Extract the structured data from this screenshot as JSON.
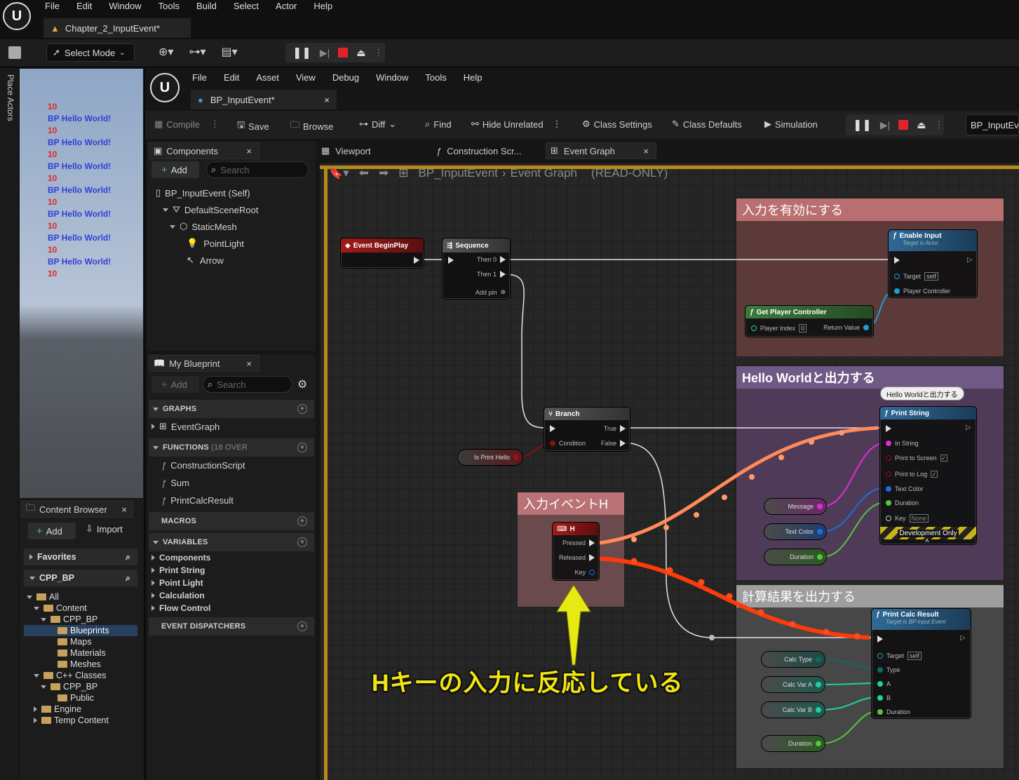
{
  "main_menu": [
    "File",
    "Edit",
    "Window",
    "Tools",
    "Build",
    "Select",
    "Actor",
    "Help"
  ],
  "level_tab": "Chapter_2_InputEvent*",
  "select_mode": "Select Mode",
  "place_actors": "Place Actors",
  "viewport_log": [
    "10",
    "BP Hello World!",
    "10",
    "BP Hello World!",
    "10",
    "BP Hello World!",
    "10",
    "BP Hello World!",
    "10",
    "BP Hello World!",
    "10",
    "BP Hello World!",
    "10",
    "BP Hello World!",
    "10"
  ],
  "bp_menu": [
    "File",
    "Edit",
    "Asset",
    "View",
    "Debug",
    "Window",
    "Tools",
    "Help"
  ],
  "bp_tab": "BP_InputEvent*",
  "toolbar": {
    "compile": "Compile",
    "save": "Save",
    "browse": "Browse",
    "diff": "Diff",
    "find": "Find",
    "hide_unrelated": "Hide Unrelated",
    "class_settings": "Class Settings",
    "class_defaults": "Class Defaults",
    "simulation": "Simulation",
    "debug_object": "BP_InputEve"
  },
  "components": {
    "tab": "Components",
    "add": "Add",
    "search_placeholder": "Search",
    "items": [
      "BP_InputEvent (Self)",
      "DefaultSceneRoot",
      "StaticMesh",
      "PointLight",
      "Arrow"
    ]
  },
  "my_blueprint": {
    "tab": "My Blueprint",
    "add": "Add",
    "search_placeholder": "Search",
    "graphs_label": "GRAPHS",
    "event_graph": "EventGraph",
    "functions_label": "FUNCTIONS",
    "functions_count": "(18 OVER",
    "functions": [
      "ConstructionScript",
      "Sum",
      "PrintCalcResult"
    ],
    "macros_label": "MACROS",
    "variables_label": "VARIABLES",
    "variables": [
      "Components",
      "Print String",
      "Point Light",
      "Calculation",
      "Flow Control"
    ],
    "dispatchers_label": "EVENT DISPATCHERS"
  },
  "content_browser": {
    "tab": "Content Browser",
    "add": "Add",
    "import": "Import",
    "favorites": "Favorites",
    "project": "CPP_BP",
    "tree": [
      "All",
      "Content",
      "CPP_BP",
      "Blueprints",
      "Maps",
      "Materials",
      "Meshes",
      "C++ Classes",
      "CPP_BP",
      "Public",
      "Engine",
      "Temp Content"
    ]
  },
  "graph_tabs": [
    "Viewport",
    "Construction Scr...",
    "Event Graph"
  ],
  "breadcrumb": {
    "bp": "BP_InputEvent",
    "graph": "Event Graph",
    "mode": "(READ-ONLY)"
  },
  "comments": {
    "enable_input": "入力を有効にする",
    "hello_world": "Hello Worldと出力する",
    "input_event": "入力イベントH",
    "calc_result": "計算結果を出力する",
    "hello_bubble": "Hello Worldと出力する"
  },
  "nodes": {
    "begin_play": "Event BeginPlay",
    "sequence": "Sequence",
    "then0": "Then 0",
    "then1": "Then 1",
    "add_pin": "Add pin",
    "enable_input": "Enable Input",
    "enable_input_sub": "Target is Actor",
    "target": "Target",
    "self": "self",
    "player_controller": "Player Controller",
    "get_pc": "Get Player Controller",
    "player_index": "Player Index",
    "index_val": "0",
    "return_value": "Return Value",
    "branch": "Branch",
    "condition": "Condition",
    "true": "True",
    "false": "False",
    "is_print_hello": "Is Print Hello",
    "print_string": "Print String",
    "in_string": "In String",
    "print_screen": "Print to Screen",
    "print_log": "Print to Log",
    "text_color": "Text Color",
    "duration": "Duration",
    "key": "Key",
    "key_val": "None",
    "dev_only": "Development Only",
    "message_var": "Message",
    "text_color_var": "Text Color",
    "duration_var": "Duration",
    "h_key": "H",
    "pressed": "Pressed",
    "released": "Released",
    "key_pin": "Key",
    "pcr": "Print Calc Result",
    "pcr_sub": "Target is BP Input Event",
    "type": "Type",
    "a": "A",
    "b": "B",
    "calc_type_var": "Calc Type",
    "calc_a_var": "Calc Var A",
    "calc_b_var": "Calc Var B",
    "duration_var2": "Duration"
  },
  "annotation": "Hキーの入力に反応している"
}
